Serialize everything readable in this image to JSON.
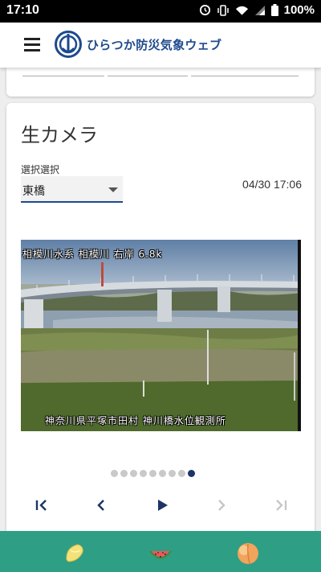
{
  "status_bar": {
    "time": "17:10",
    "battery": "100%"
  },
  "app": {
    "title": "ひらつか防災気象ウェブ"
  },
  "camera": {
    "title": "生カメラ",
    "select_label": "選択選択",
    "selected_location": "東橋",
    "timestamp": "04/30 17:06",
    "overlay_top": "相模川水系 相模川 右岸 6.8k",
    "overlay_bottom": "神奈川県平塚市田村  神川橋水位観測所"
  },
  "carousel": {
    "dot_count": 9,
    "active_index": 8
  },
  "colors": {
    "brand": "#1d4a8e",
    "bottom_bar": "#2e9e85",
    "active_dot": "#1d3466"
  },
  "bottom_nav": {
    "items": [
      "lemon-icon",
      "watermelon-icon",
      "peach-icon"
    ]
  }
}
